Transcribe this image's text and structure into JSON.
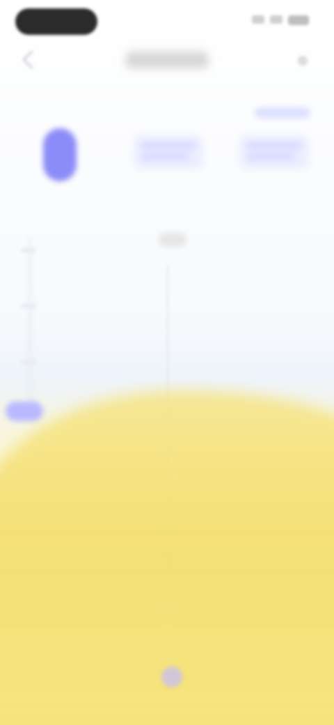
{
  "status_bar": {
    "time": "",
    "icons": [
      "signal-icon",
      "wifi-icon",
      "battery-icon"
    ]
  },
  "header": {
    "title": "",
    "back_icon": "chevron-left-icon",
    "more_icon": "more-icon"
  },
  "top_link": {
    "label": ""
  },
  "steps": {
    "step_icon": "step-icon",
    "cards": [
      {
        "line1": "",
        "line2": ""
      },
      {
        "line1": "",
        "line2": ""
      }
    ]
  },
  "center": {
    "label": ""
  },
  "colors": {
    "accent": "#8c8cf8",
    "accent_light": "#eceeff",
    "yellow": "#f2df77"
  }
}
